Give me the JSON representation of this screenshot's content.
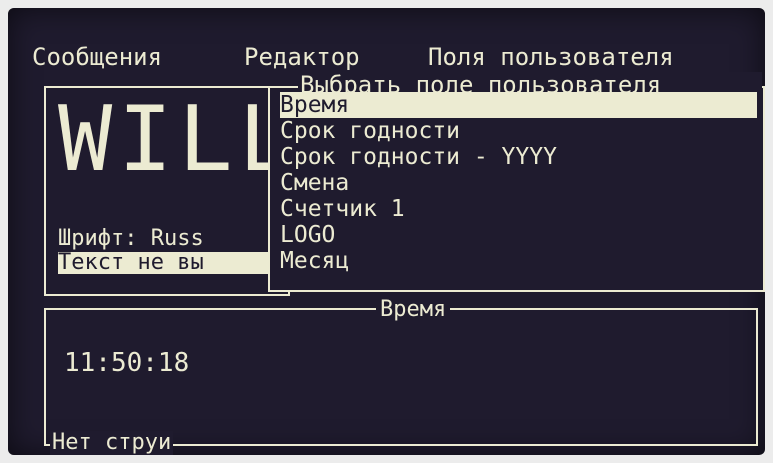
{
  "menu": {
    "items": [
      {
        "label": "Сообщения"
      },
      {
        "label": "Редактор"
      },
      {
        "label": "Поля пользователя"
      }
    ]
  },
  "message_panel": {
    "preview_text": "WILL",
    "font_label": "Шрифт: Russ",
    "warning_text": "Текст не вы"
  },
  "user_field_dialog": {
    "title": "Выбрать поле пользователя",
    "options": [
      {
        "label": "Время",
        "selected": true
      },
      {
        "label": "Срок годности",
        "selected": false
      },
      {
        "label": "Срок годности - YYYY",
        "selected": false
      },
      {
        "label": "Смена",
        "selected": false
      },
      {
        "label": "Счетчик 1",
        "selected": false
      },
      {
        "label": "LOGO",
        "selected": false
      },
      {
        "label": "Месяц",
        "selected": false
      }
    ]
  },
  "time_panel": {
    "title": "Время",
    "value": "11:50:18"
  },
  "status_bar": {
    "text": "Нет струи"
  },
  "colors": {
    "background": "#1f1b2e",
    "foreground": "#ecebd2"
  }
}
